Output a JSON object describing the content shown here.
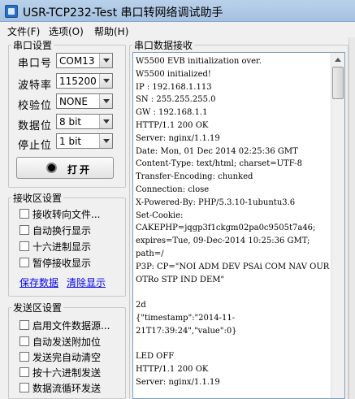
{
  "window": {
    "title": "USR-TCP232-Test 串口转网络调试助手"
  },
  "menu": {
    "file": "文件(F)",
    "options": "选项(O)",
    "help": "帮助(H)"
  },
  "serial_settings": {
    "title": "串口设置",
    "port": {
      "label": "串口号",
      "value": "COM13"
    },
    "baud": {
      "label": "波特率",
      "value": "115200"
    },
    "parity": {
      "label": "校验位",
      "value": "NONE"
    },
    "data_bits": {
      "label": "数据位",
      "value": "8 bit"
    },
    "stop_bits": {
      "label": "停止位",
      "value": "1 bit"
    },
    "open_button": "打开"
  },
  "receive_settings": {
    "title": "接收区设置",
    "options": [
      {
        "label": "接收转向文件...",
        "checked": false
      },
      {
        "label": "自动换行显示",
        "checked": false
      },
      {
        "label": "十六进制显示",
        "checked": false
      },
      {
        "label": "暂停接收显示",
        "checked": false
      }
    ],
    "save_link": "保存数据",
    "clear_link": "清除显示"
  },
  "send_settings": {
    "title": "发送区设置",
    "options": [
      {
        "label": "启用文件数据源...",
        "checked": false
      },
      {
        "label": "自动发送附加位",
        "checked": false
      },
      {
        "label": "发送完自动清空",
        "checked": false
      },
      {
        "label": "按十六进制发送",
        "checked": false
      },
      {
        "label": "数据流循环发送",
        "checked": false
      }
    ]
  },
  "receive_area": {
    "title": "串口数据接收",
    "text": "W5500 EVB initialization over.\nW5500 initialized!\nIP : 192.168.1.113\nSN : 255.255.255.0\nGW : 192.168.1.1\nHTTP/1.1 200 OK\nServer: nginx/1.1.19\nDate: Mon, 01 Dec 2014 02:25:36 GMT\nContent-Type: text/html; charset=UTF-8\nTransfer-Encoding: chunked\nConnection: close\nX-Powered-By: PHP/5.3.10-1ubuntu3.6\nSet-Cookie:\nCAKEPHP=jqgp3f1ckgm02pa0c9505t7a46;\nexpires=Tue, 09-Dec-2014 10:25:36 GMT;\npath=/\nP3P: CP=\"NOI ADM DEV PSAi COM NAV OUR\nOTRo STP IND DEM\"\n\n2d\n{\"timestamp\":\"2014-11-\n21T17:39:24\",\"value\":0}\n\nLED OFF\nHTTP/1.1 200 OK\nServer: nginx/1.1.19"
  }
}
